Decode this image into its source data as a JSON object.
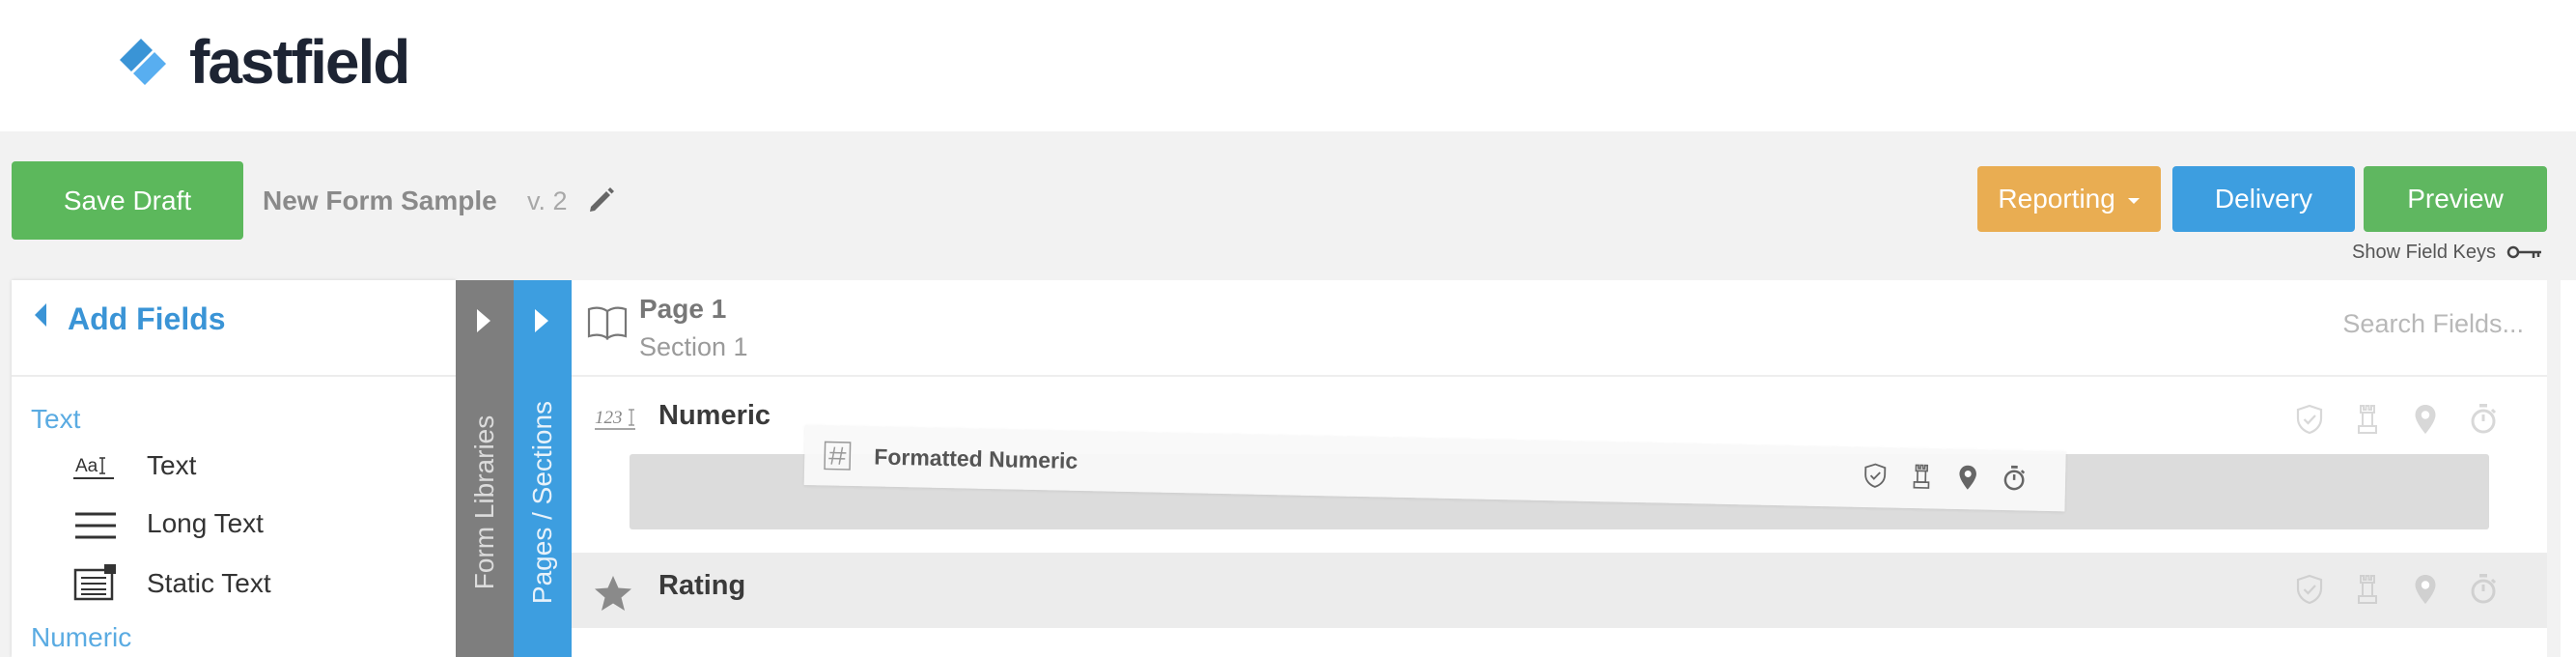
{
  "header": {
    "brand": "fastfield"
  },
  "toolbar": {
    "save_label": "Save Draft",
    "form_name": "New Form Sample",
    "form_version": "v. 2",
    "reporting_label": "Reporting",
    "delivery_label": "Delivery",
    "preview_label": "Preview",
    "field_keys_label": "Show Field Keys"
  },
  "sidebar": {
    "title": "Add Fields",
    "categories": [
      {
        "label": "Text",
        "items": [
          {
            "label": "Text",
            "icon": "text-field-icon"
          },
          {
            "label": "Long Text",
            "icon": "long-text-icon"
          },
          {
            "label": "Static Text",
            "icon": "static-text-icon"
          }
        ]
      },
      {
        "label": "Numeric",
        "items": []
      }
    ]
  },
  "tabs": {
    "libraries": "Form Libraries",
    "pages": "Pages / Sections"
  },
  "canvas": {
    "page_title": "Page 1",
    "section_title": "Section 1",
    "search_placeholder": "Search Fields...",
    "numeric_icon_text": "123",
    "fields": [
      {
        "label": "Numeric",
        "icon": "numeric-icon"
      },
      {
        "label": "Rating",
        "icon": "star-icon"
      }
    ],
    "field_action_icons": [
      "shield-icon",
      "chess-rook-icon",
      "location-pin-icon",
      "stopwatch-icon"
    ],
    "dragging": {
      "label": "Formatted Numeric",
      "icon": "hash-icon"
    }
  },
  "colors": {
    "save": "#5cb85c",
    "reporting": "#e9ad52",
    "delivery": "#3d9ee0",
    "preview": "#5fb760",
    "accent": "#3a94d6",
    "brand_dark": "#1d2433"
  }
}
